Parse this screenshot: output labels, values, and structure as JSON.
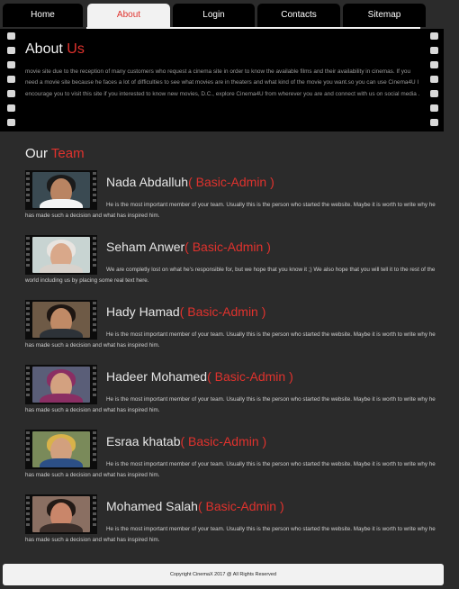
{
  "nav": {
    "tabs": [
      {
        "label": "Home",
        "active": false
      },
      {
        "label": "About",
        "active": true
      },
      {
        "label": "Login",
        "active": false
      },
      {
        "label": "Contacts",
        "active": false
      },
      {
        "label": "Sitemap",
        "active": false
      }
    ]
  },
  "about": {
    "title_main": "About",
    "title_accent": "Us",
    "text": "movie site due to the reception of many customers who request a cinema site in order to know the available films and their availability in cinemas. If you need a movie site because he faces a lot of difficulties to see what movies are in theaters and what kind of the movie you want.so you can use Cinema4U I encourage you to visit this site if you interested to know new movies, D.C., explore Cinema4U from wherever you are and connect with us on social media ."
  },
  "team": {
    "title_main": "Our",
    "title_accent": "Team",
    "members": [
      {
        "name": "Nada Abdalluh",
        "role": "( Basic-Admin )",
        "text": "He is the most important member of your team. Usually this is the person who started the website. Maybe it is worth to write why he has made such a decision and what has inspired him."
      },
      {
        "name": "Seham Anwer",
        "role": "( Basic-Admin )",
        "text": "We are completly lost on what he's responsible for, but we hope that you know it ;) We also hope that you will tell it to the rest of the world including us by placing some real text here."
      },
      {
        "name": "Hady Hamad",
        "role": "( Basic-Admin )",
        "text": "He is the most important member of your team. Usually this is the person who started the website. Maybe it is worth to write why he has made such a decision and what has inspired him."
      },
      {
        "name": "Hadeer Mohamed",
        "role": "( Basic-Admin )",
        "text": "He is the most important member of your team. Usually this is the person who started the website. Maybe it is worth to write why he has made such a decision and what has inspired him."
      },
      {
        "name": "Esraa khatab",
        "role": "( Basic-Admin )",
        "text": "He is the most important member of your team. Usually this is the person who started the website. Maybe it is worth to write why he has made such a decision and what has inspired him."
      },
      {
        "name": "Mohamed Salah",
        "role": "( Basic-Admin )",
        "text": "He is the most important member of your team. Usually this is the person who started the website. Maybe it is worth to write why he has made such a decision and what has inspired him."
      }
    ]
  },
  "footer": {
    "copyright": "Copyright CinemaX 2017 @ All Rights Reserved"
  },
  "colors": {
    "accent": "#e0322d",
    "background": "#2b2b2b",
    "panel": "#000000",
    "footer": "#f2f2f2"
  }
}
